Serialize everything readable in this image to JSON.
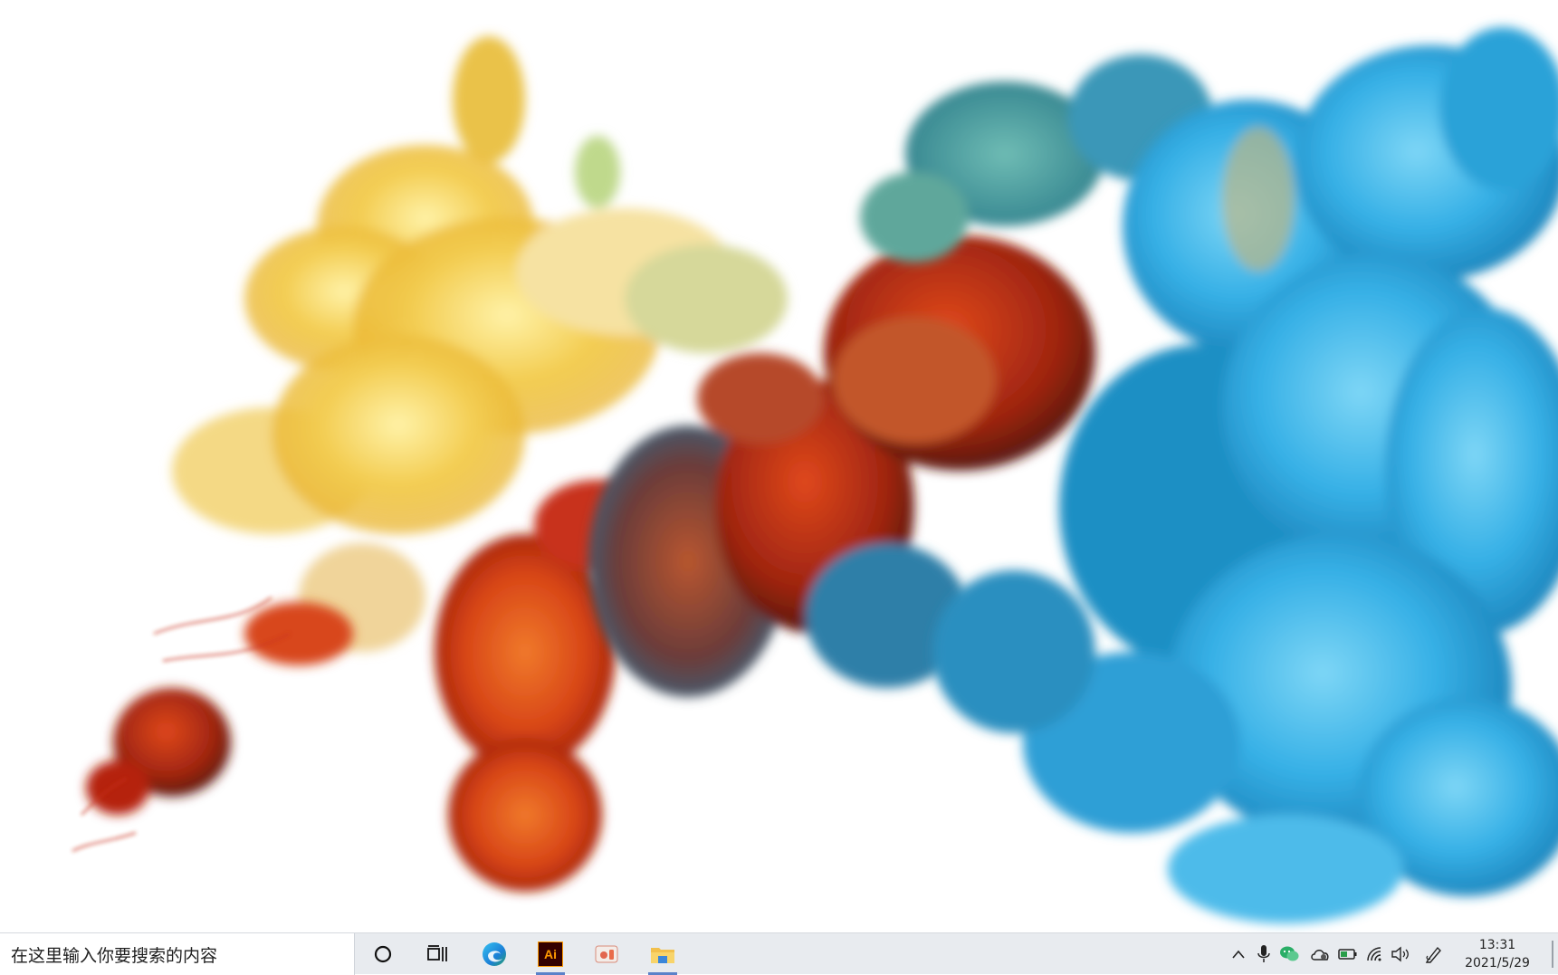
{
  "desktop": {
    "wallpaper": "ink-in-water-abstract",
    "colors": {
      "background": "#ffffff",
      "yellow": "#f2c94c",
      "orange": "#e0561f",
      "red": "#b8210e",
      "teal": "#4fa3a5",
      "blue": "#2aa7e0",
      "light_blue": "#5cc6f0"
    }
  },
  "taskbar": {
    "background": "#e8ebef",
    "search_placeholder": "在这里输入你要搜索的内容",
    "buttons": [
      {
        "name": "cortana-button",
        "icon": "circle-icon"
      },
      {
        "name": "task-view-button",
        "icon": "task-view-icon"
      },
      {
        "name": "edge-button",
        "icon": "edge-icon"
      },
      {
        "name": "illustrator-button",
        "icon": "illustrator-icon",
        "label": "Ai"
      },
      {
        "name": "paint3d-button",
        "icon": "paint-icon"
      },
      {
        "name": "file-explorer-button",
        "icon": "folder-icon"
      }
    ],
    "tray": [
      "chevron-up-icon",
      "microphone-icon",
      "wechat-icon",
      "onedrive-icon",
      "battery-icon",
      "wifi-icon",
      "volume-icon",
      "pen-icon"
    ],
    "clock": {
      "time": "13:31",
      "date": "2021/5/29"
    }
  }
}
